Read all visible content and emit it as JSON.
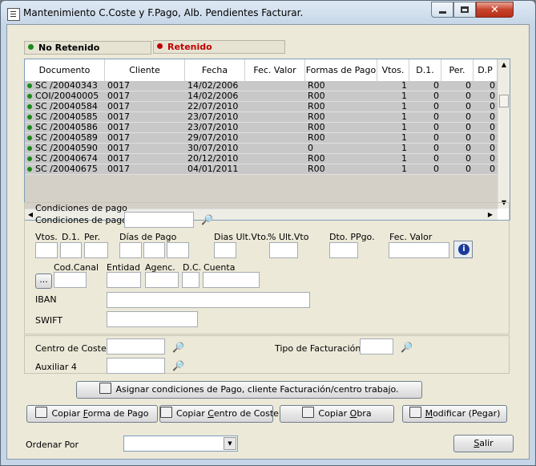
{
  "window": {
    "title": "Mantenimiento C.Coste y F.Pago, Alb. Pendientes Facturar."
  },
  "legend": {
    "no_retenido": {
      "label": "No Retenido",
      "color": "#1a8a1a"
    },
    "retenido": {
      "label": "Retenido",
      "color": "#c00000"
    }
  },
  "grid": {
    "columns": [
      "Documento",
      "Cliente",
      "Fecha",
      "Fec. Valor",
      "Formas de Pago",
      "Vtos.",
      "D.1.",
      "Per.",
      "D.P"
    ],
    "rows": [
      {
        "documento": "SC /20040343",
        "cliente": "0017",
        "fecha": "14/02/2006",
        "fec_valor": "",
        "forma": "R00",
        "vtos": "1",
        "d1": "0",
        "per": "0",
        "dp": "0"
      },
      {
        "documento": "COI/20040005",
        "cliente": "0017",
        "fecha": "14/02/2006",
        "fec_valor": "",
        "forma": "R00",
        "vtos": "1",
        "d1": "0",
        "per": "0",
        "dp": "0"
      },
      {
        "documento": "SC /20040584",
        "cliente": "0017",
        "fecha": "22/07/2010",
        "fec_valor": "",
        "forma": "R00",
        "vtos": "1",
        "d1": "0",
        "per": "0",
        "dp": "0"
      },
      {
        "documento": "SC /20040585",
        "cliente": "0017",
        "fecha": "23/07/2010",
        "fec_valor": "",
        "forma": "R00",
        "vtos": "1",
        "d1": "0",
        "per": "0",
        "dp": "0"
      },
      {
        "documento": "SC /20040586",
        "cliente": "0017",
        "fecha": "23/07/2010",
        "fec_valor": "",
        "forma": "R00",
        "vtos": "1",
        "d1": "0",
        "per": "0",
        "dp": "0"
      },
      {
        "documento": "SC /20040589",
        "cliente": "0017",
        "fecha": "29/07/2010",
        "fec_valor": "",
        "forma": "R00",
        "vtos": "1",
        "d1": "0",
        "per": "0",
        "dp": "0"
      },
      {
        "documento": "SC /20040590",
        "cliente": "0017",
        "fecha": "30/07/2010",
        "fec_valor": "",
        "forma": "0",
        "vtos": "1",
        "d1": "0",
        "per": "0",
        "dp": "0"
      },
      {
        "documento": "SC /20040674",
        "cliente": "0017",
        "fecha": "20/12/2010",
        "fec_valor": "",
        "forma": "R00",
        "vtos": "1",
        "d1": "0",
        "per": "0",
        "dp": "0"
      },
      {
        "documento": "SC /20040675",
        "cliente": "0017",
        "fecha": "04/01/2011",
        "fec_valor": "",
        "forma": "R00",
        "vtos": "1",
        "d1": "0",
        "per": "0",
        "dp": "0"
      }
    ]
  },
  "condiciones": {
    "group_title": "Condiciones de pago",
    "field_label": "Condiciones de pago",
    "vtos": "Vtos.",
    "d1": "D.1.",
    "per": "Per.",
    "dias_de_pago": "Días de Pago",
    "dias_ult_vto": "Dias Ult.Vto.",
    "pct_ult_vto": "% Ult.Vto",
    "dto_ppgo": "Dto. PPgo.",
    "fec_valor": "Fec. Valor",
    "cod_canal": "Cod.Canal",
    "entidad": "Entidad",
    "agenc": "Agenc.",
    "dc": "D.C.",
    "cuenta": "Cuenta",
    "iban": "IBAN",
    "swift": "SWIFT",
    "dots_button": "..."
  },
  "coste": {
    "centro_de_coste": "Centro de Coste",
    "auxiliar_4": "Auxiliar 4",
    "tipo_facturacion": "Tipo de Facturación"
  },
  "buttons": {
    "asignar": "Asignar condiciones de Pago, cliente Facturación/centro trabajo.",
    "copiar_forma_pre": "Copiar ",
    "copiar_forma_u": "F",
    "copiar_forma_post": "orma de Pago",
    "copiar_centro_pre": "Copiar ",
    "copiar_centro_u": "C",
    "copiar_centro_post": "entro de Coste",
    "copiar_obra_pre": "Copiar ",
    "copiar_obra_u": "O",
    "copiar_obra_post": "bra",
    "modificar_u": "M",
    "modificar_post": "odificar (Pegar)",
    "salir_u": "S",
    "salir_post": "alir"
  },
  "ordenar": {
    "label": "Ordenar Por",
    "value": ""
  }
}
